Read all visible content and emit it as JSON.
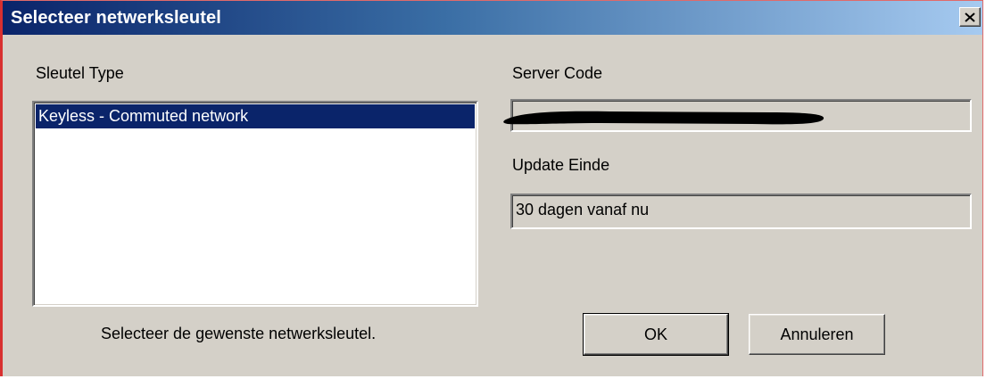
{
  "window": {
    "title": "Selecteer netwerksleutel",
    "close_icon": "close-icon"
  },
  "left": {
    "list_label": "Sleutel Type",
    "items": [
      {
        "label": "Keyless - Commuted network",
        "selected": true
      }
    ],
    "hint": "Selecteer de gewenste netwerksleutel."
  },
  "right": {
    "server_code_label": "Server Code",
    "server_code_value": "",
    "update_end_label": "Update Einde",
    "update_end_value": "30 dagen vanaf nu"
  },
  "buttons": {
    "ok": "OK",
    "cancel": "Annuleren"
  },
  "colors": {
    "selection": "#0a246a",
    "face": "#d4d0c8",
    "title_start": "#0a246a",
    "title_end": "#a6caf0"
  }
}
